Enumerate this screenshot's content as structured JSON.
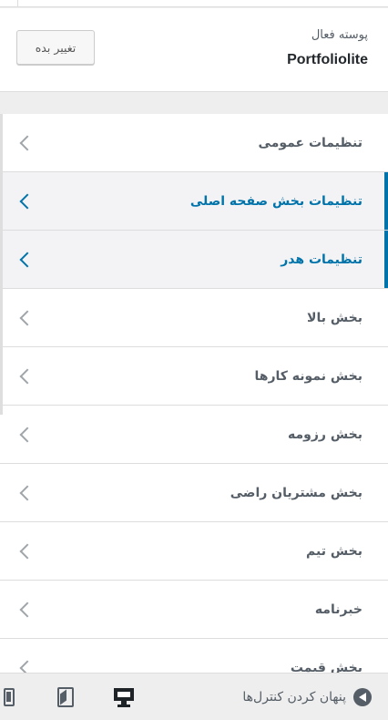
{
  "theme": {
    "active_label": "پوسته فعال",
    "name": "Portfoliolite",
    "change_button": "تغییر بده"
  },
  "sections": [
    {
      "label": "تنظیمات عمومی",
      "active": false
    },
    {
      "label": "تنظیمات بخش صفحه اصلی",
      "active": true
    },
    {
      "label": "تنظیمات هدر",
      "active": true
    },
    {
      "label": "بخش بالا",
      "active": false
    },
    {
      "label": "بخش نمونه کارها",
      "active": false
    },
    {
      "label": "بخش رزومه",
      "active": false
    },
    {
      "label": "بخش مشتریان راضی",
      "active": false
    },
    {
      "label": "بخش تیم",
      "active": false
    },
    {
      "label": "خبرنامه",
      "active": false
    },
    {
      "label": "بخش قیمت",
      "active": false
    }
  ],
  "footer": {
    "collapse_label": "پنهان کردن کنترل‌ها",
    "devices": [
      "desktop-icon",
      "tablet-icon",
      "mobile-icon"
    ]
  },
  "colors": {
    "accent": "#0073aa",
    "text": "#555d66"
  }
}
